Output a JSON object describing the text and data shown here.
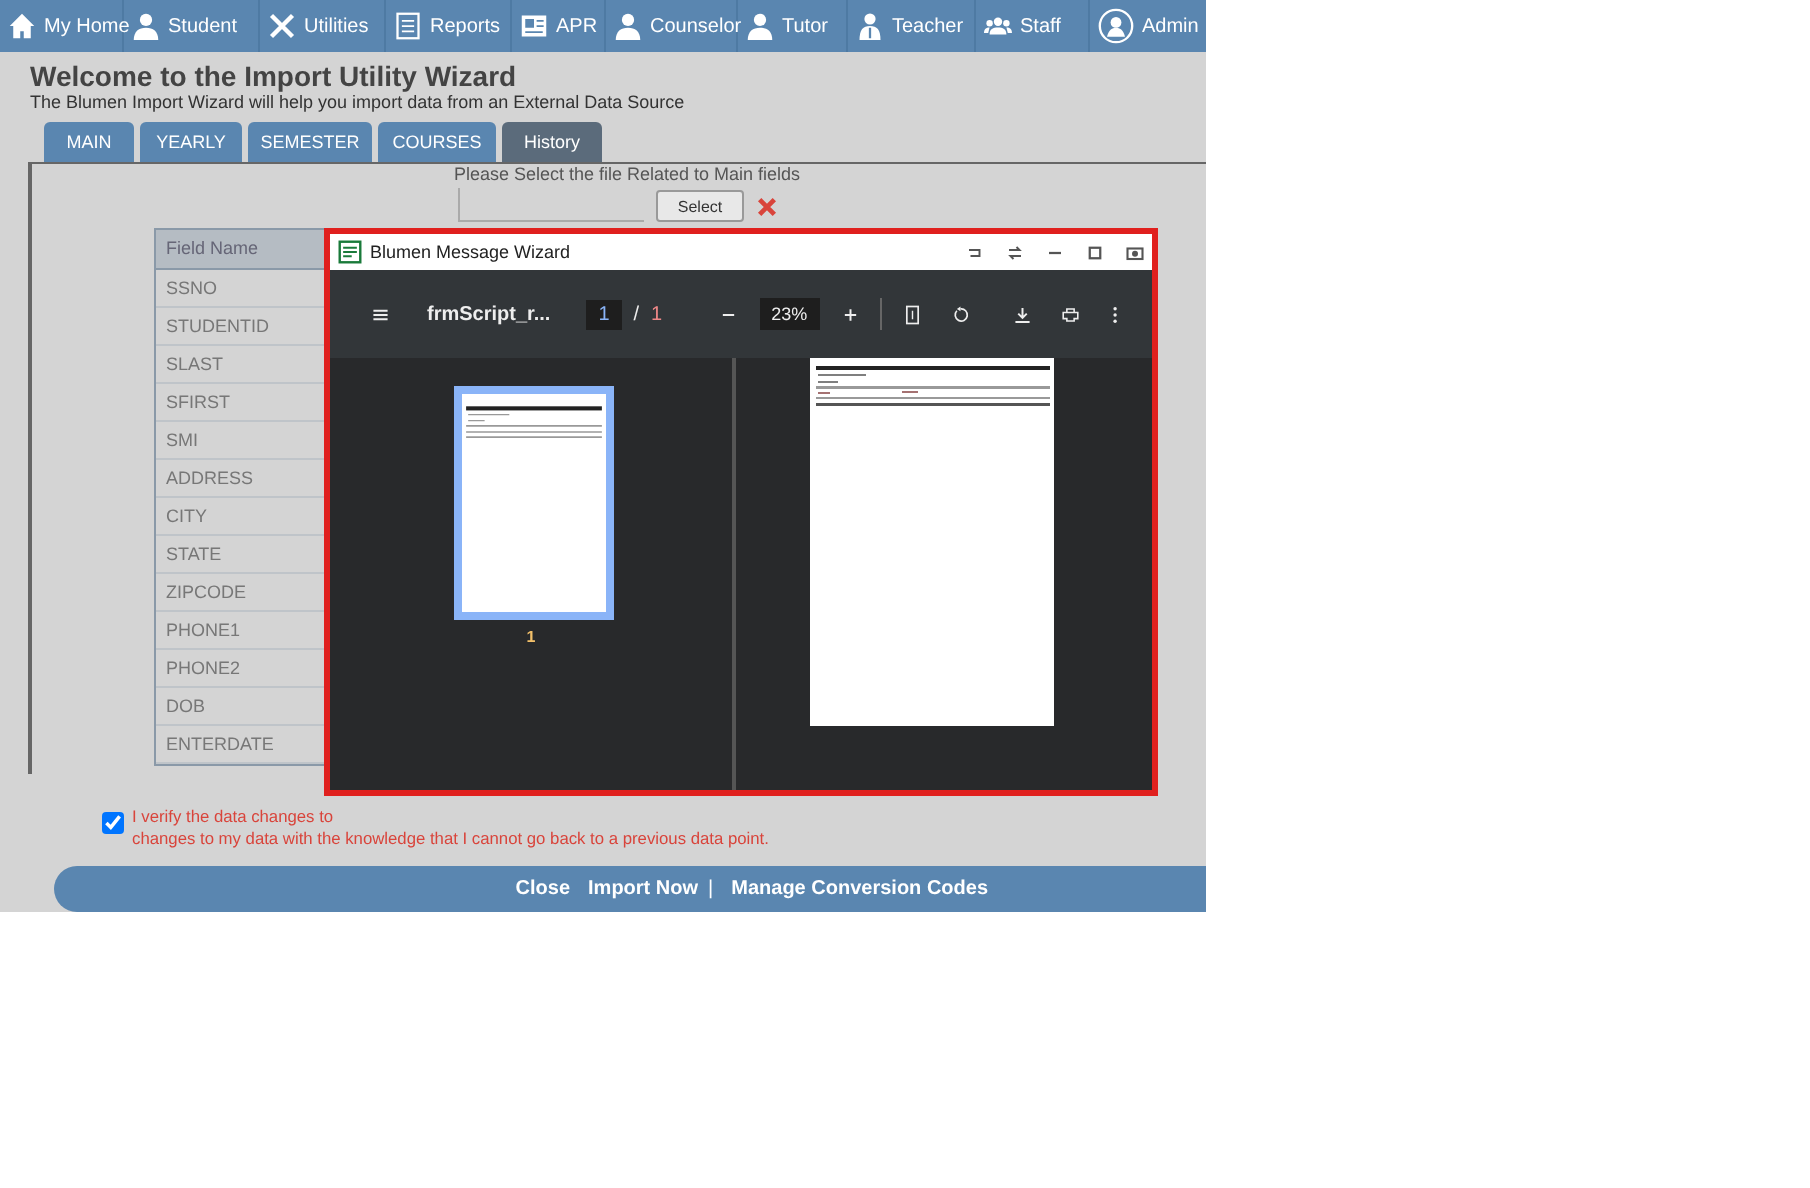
{
  "nav": [
    {
      "label": "My Home"
    },
    {
      "label": "Student"
    },
    {
      "label": "Utilities"
    },
    {
      "label": "Reports"
    },
    {
      "label": "APR"
    },
    {
      "label": "Counselor"
    },
    {
      "label": "Tutor"
    },
    {
      "label": "Teacher"
    },
    {
      "label": "Staff"
    },
    {
      "label": "Admin"
    }
  ],
  "page": {
    "title": "Welcome to the Import Utility Wizard",
    "subtitle": "The Blumen Import Wizard will help you import data from an External Data Source"
  },
  "tabs": [
    {
      "label": "MAIN",
      "selected": false
    },
    {
      "label": "YEARLY",
      "selected": false
    },
    {
      "label": "SEMESTER",
      "selected": false
    },
    {
      "label": "COURSES",
      "selected": false
    },
    {
      "label": "History",
      "selected": true
    }
  ],
  "file_prompt": "Please Select the file Related to Main fields",
  "select_button": "Select",
  "table": {
    "header": "Field Name",
    "rows": [
      "SSNO",
      "STUDENTID",
      "SLAST",
      "SFIRST",
      "SMI",
      "ADDRESS",
      "CITY",
      "STATE",
      "ZIPCODE",
      "PHONE1",
      "PHONE2",
      "DOB",
      "ENTERDATE"
    ]
  },
  "dialog": {
    "title": "Blumen Message Wizard",
    "file_name": "frmScript_r...",
    "page_input": "1",
    "page_separator": "/",
    "page_total": "1",
    "zoom": "23%",
    "thumbnail_label": "1"
  },
  "verify": {
    "checked": true,
    "line1": "I verify the data changes to",
    "line2": "changes to my data with the knowledge that I cannot go back to a previous data point."
  },
  "footer": [
    {
      "kind": "link",
      "label": "Close"
    },
    {
      "kind": "link",
      "label": "Import Now"
    },
    {
      "kind": "separator",
      "label": "|"
    },
    {
      "kind": "link",
      "label": "Manage Conversion Codes"
    }
  ]
}
